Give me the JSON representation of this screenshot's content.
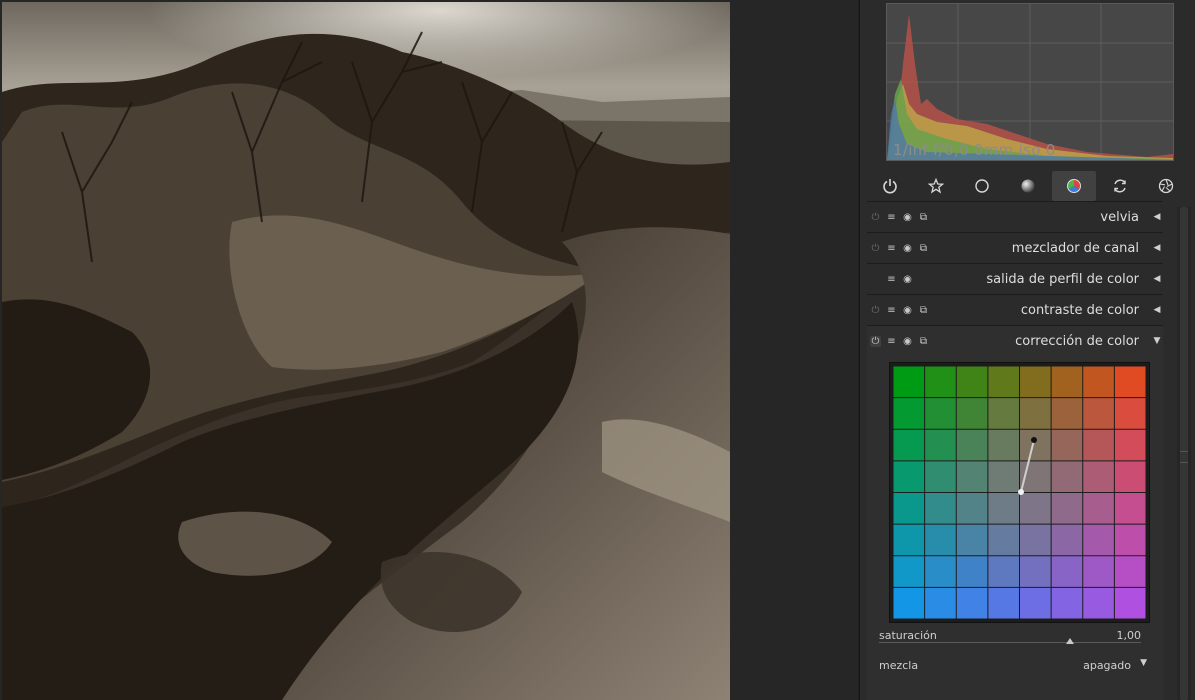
{
  "histogram": {
    "exif_info": "1/inf f/0,0 0mm iso 0"
  },
  "group_tabs": [
    {
      "icon": "power-icon",
      "active": false
    },
    {
      "icon": "star-icon",
      "active": false
    },
    {
      "icon": "circle-icon",
      "active": false
    },
    {
      "icon": "tone-sphere-icon",
      "active": false
    },
    {
      "icon": "color-wheel-icon",
      "active": true
    },
    {
      "icon": "correct-rotate-icon",
      "active": false
    },
    {
      "icon": "effect-aperture-icon",
      "active": false
    }
  ],
  "modules": [
    {
      "name": "velvia",
      "arrow": "◀",
      "has_power": true,
      "has_presets": true
    },
    {
      "name": "mezclador de canal",
      "arrow": "◀",
      "has_power": true,
      "has_presets": true
    },
    {
      "name": "salida de perfil de color",
      "arrow": "◀",
      "has_power": false,
      "has_presets": false
    },
    {
      "name": "contraste de color",
      "arrow": "◀",
      "has_power": true,
      "has_presets": true
    },
    {
      "name": "corrección de color",
      "arrow": "▼",
      "has_power": true,
      "has_presets": true,
      "expanded": true
    }
  ],
  "color_correction": {
    "saturation_label": "saturación",
    "saturation_value": "1,00",
    "saturation_fraction": 0.73,
    "blend_label": "mezcla",
    "blend_value": "apagado",
    "blend_arrow": "▼",
    "grid_size": 8
  }
}
